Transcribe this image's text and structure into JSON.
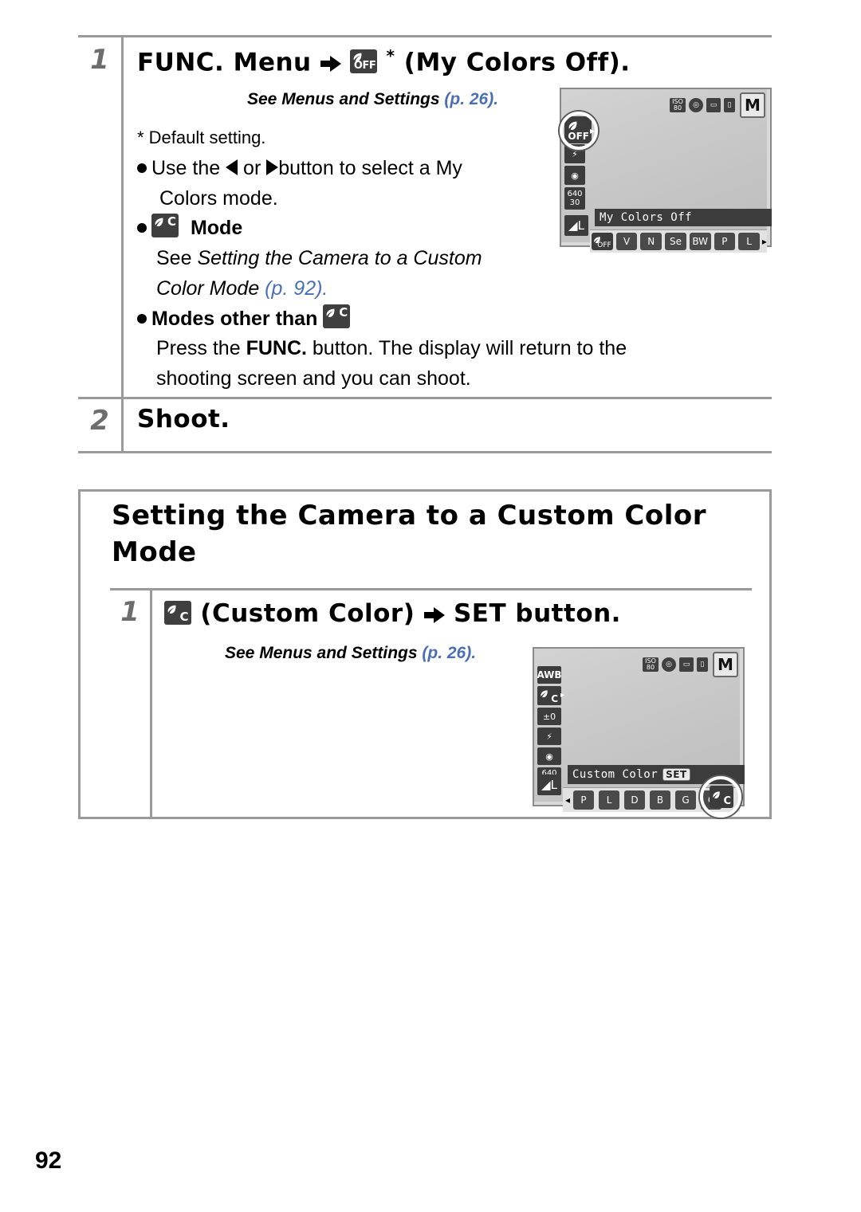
{
  "page": {
    "number": "92"
  },
  "step1": {
    "number": "1",
    "title_a": "FUNC. Menu",
    "title_icon": "my-colors-off-icon",
    "title_asterisk": "*",
    "title_b": "(My Colors Off).",
    "see_ref": "See Menus and Settings ",
    "see_ref_page": "(p. 26).",
    "default_note": "* Default setting.",
    "bullet1_a": "Use the ",
    "bullet1_b": " or ",
    "bullet1_c": "button to select a My",
    "bullet1_d": "Colors mode.",
    "bullet2_label": "Mode",
    "bullet2_icon": "custom-color-icon",
    "bullet2_line1": "See ",
    "bullet2_line1_ital": "Setting the Camera to a Custom",
    "bullet2_line2_ital": "Color Mode ",
    "bullet2_line2_page": "(p. 92).",
    "bullet3_label": "Modes other than ",
    "bullet3_icon": "custom-color-icon",
    "bullet3_line1_a": "Press the ",
    "bullet3_line1_bold": "FUNC.",
    "bullet3_line1_b": " button. The display will return to the",
    "bullet3_line2": "shooting screen and you can shoot."
  },
  "step2": {
    "number": "2",
    "title": "Shoot."
  },
  "section": {
    "title_line1": "Setting the Camera to a Custom",
    "title_line2": "Mode",
    "step": {
      "number": "1",
      "icon": "custom-color-icon",
      "title_a": "(Custom Color)",
      "title_b": "SET",
      "title_c": "button.",
      "see_ref": "See Menus and Settings ",
      "see_ref_page": "(p. 26)."
    }
  },
  "lcd_top": {
    "top_icons": [
      "ISO-AUTO",
      "white-balance-icon",
      "frame-icon",
      "battery-icon"
    ],
    "mode_label": "M",
    "left_column": [
      "my-colors-off-icon",
      "flash-icon",
      "metering-icon",
      "resolution-640-30"
    ],
    "quality_label": "L",
    "status_label": "My Colors Off",
    "options": [
      "OFF",
      "V",
      "N",
      "Se",
      "BW",
      "P",
      "L"
    ],
    "selected_option": "OFF",
    "highlight_icon": "my-colors-off-selected"
  },
  "lcd_bottom": {
    "top_icons": [
      "ISO-AUTO",
      "white-balance-icon",
      "frame-icon",
      "battery-icon"
    ],
    "mode_label": "M",
    "left_column": [
      "AWB",
      "custom-color-icon",
      "exposure-icon",
      "flash-icon",
      "metering-icon",
      "resolution-640-30"
    ],
    "quality_label": "L",
    "status_label": "Custom Color",
    "set_badge": "SET",
    "options": [
      "P",
      "L",
      "D",
      "B",
      "G",
      "C"
    ],
    "selected_option": "C"
  }
}
